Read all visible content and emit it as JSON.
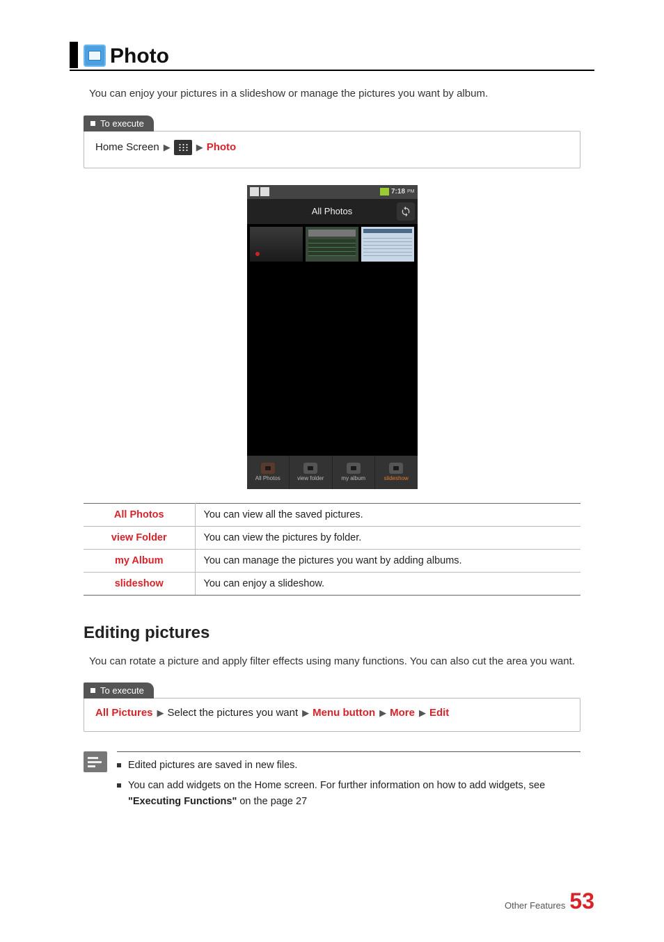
{
  "header": {
    "title": "Photo"
  },
  "intro": "You can enjoy your pictures in a slideshow or manage the pictures you want by album.",
  "exec": {
    "tab": "To execute",
    "path1": {
      "a": "Home Screen",
      "b": "Photo"
    }
  },
  "phone": {
    "time": "7:18",
    "time_suffix": "PM",
    "screen_title": "All Photos",
    "tabs": [
      "All Photos",
      "view folder",
      "my album",
      "slideshow"
    ]
  },
  "table": [
    {
      "name": "All Photos",
      "desc": "You can view all the saved pictures."
    },
    {
      "name": "view Folder",
      "desc": "You can view the pictures by folder."
    },
    {
      "name": "my Album",
      "desc": "You can manage the pictures you want by adding albums."
    },
    {
      "name": "slideshow",
      "desc": "You can enjoy a slideshow."
    }
  ],
  "subhead": "Editing pictures",
  "sub_intro": "You can rotate a picture and apply filter effects using many functions. You can also cut the area you want.",
  "exec2": {
    "tab": "To execute",
    "a": "All Pictures",
    "b": "Select the pictures you want",
    "c": "Menu button",
    "d": "More",
    "e": "Edit"
  },
  "notes": {
    "n1": "Edited pictures are saved in new files.",
    "n2a": "You can add widgets on the Home screen. For further information on how to add widgets, see ",
    "n2b": "\"Executing Functions\"",
    "n2c": " on the page 27"
  },
  "footer": {
    "section": "Other Features",
    "page": "53"
  }
}
